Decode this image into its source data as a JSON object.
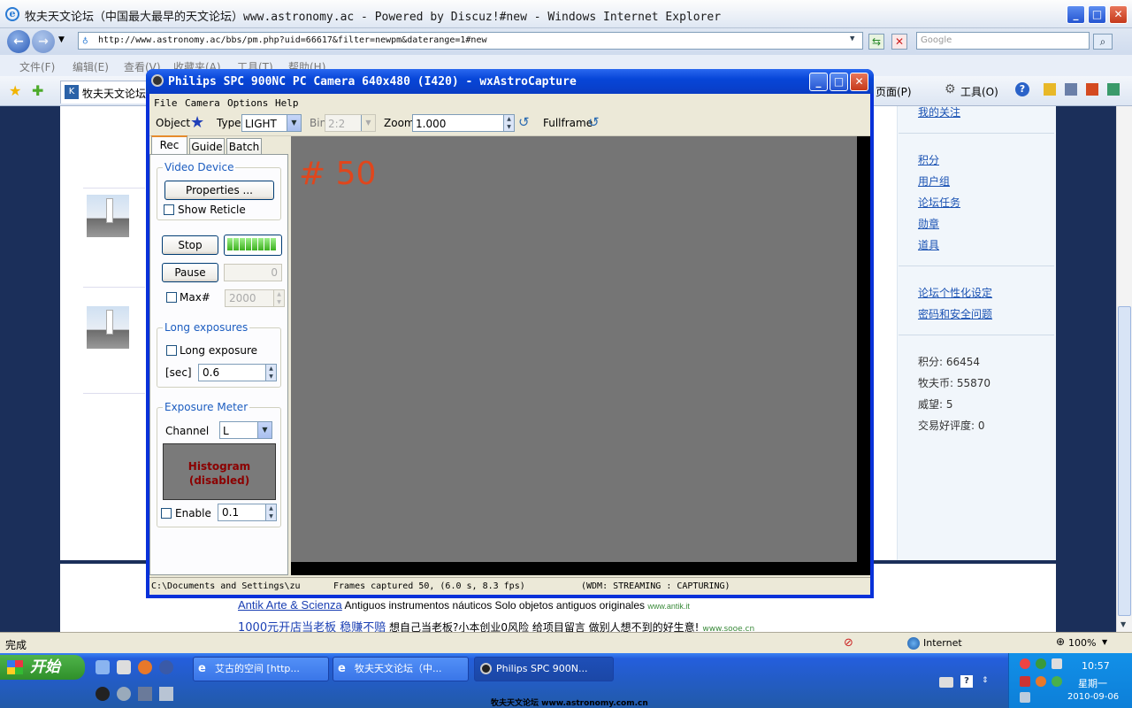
{
  "browser": {
    "title": "牧夫天文论坛（中国最大最早的天文论坛）www.astronomy.ac - Powered by Discuz!#new - Windows Internet Explorer",
    "address": "http://www.astronomy.ac/bbs/pm.php?uid=66617&filter=newpm&daterange=1#new",
    "search_placeholder": "Google",
    "menu": [
      "文件(F)",
      "编辑(E)",
      "查看(V)",
      "收藏夹(A)",
      "工具(T)",
      "帮助(H)"
    ],
    "fav_tab": "牧夫天文论坛",
    "cmd_page": "页面(P)",
    "cmd_tools": "工具(O)",
    "status_left": "完成",
    "status_zone": "Internet",
    "status_zoom": "100%"
  },
  "page": {
    "top_link": "我的关注",
    "right_links": [
      "积分",
      "用户组",
      "论坛任务",
      "勋章",
      "道具"
    ],
    "right_links2": [
      "论坛个性化设定",
      "密码和安全问题"
    ],
    "stats": [
      "积分: 66454",
      "牧夫币: 55870",
      "威望: 5",
      "交易好评度: 0"
    ],
    "ad1_title": "Antik Arte & Scienza",
    "ad1_text": "Antiguos instrumentos náuticos Solo objetos antiguos originales",
    "ad1_url": "www.antik.it",
    "ad2_title": "1000元开店当老板  稳赚不赔",
    "ad2_text": "想自己当老板?小本创业0风险  给项目留言  做别人想不到的好生意!",
    "ad2_url": "www.sooe.cn"
  },
  "app": {
    "title": "Philips SPC 900NC PC Camera 640x480 (I420) - wxAstroCapture",
    "menu": [
      "File",
      "Camera",
      "Options",
      "Help"
    ],
    "toolbar": {
      "object_label": "Object",
      "type_label": "Type",
      "type_value": "LIGHT",
      "bin_label": "Bin",
      "bin_value": "2:2",
      "zoom_label": "Zoom",
      "zoom_value": "1.000",
      "fullframe_label": "Fullframe"
    },
    "tabs": [
      "Rec",
      "Guide",
      "Batch"
    ],
    "video_device_title": "Video Device",
    "properties_btn": "Properties ...",
    "show_reticle": "Show Reticle",
    "stop_btn": "Stop",
    "pause_btn": "Pause",
    "pause_value": "0",
    "max_label": "Max#",
    "max_value": "2000",
    "long_exp_title": "Long exposures",
    "long_exp_chk": "Long exposure",
    "sec_label": "[sec]",
    "sec_value": "0.6",
    "exp_meter_title": "Exposure Meter",
    "channel_label": "Channel",
    "channel_value": "L",
    "histogram_line1": "Histogram",
    "histogram_line2": "(disabled)",
    "enable_label": "Enable",
    "enable_value": "0.1",
    "overlay_text": "# 50",
    "status_path": "C:\\Documents and Settings\\zu",
    "status_frames": "Frames captured 50,  (6.0 s, 8.3 fps)",
    "status_mode": "(WDM: STREAMING : CAPTURING)"
  },
  "taskbar": {
    "start": "开始",
    "tasks": [
      "艾古的空间 [http...",
      "牧夫天文论坛（中...",
      "Philips SPC 900N..."
    ],
    "time": "10:57",
    "weekday": "星期一",
    "date": "2010-09-06",
    "watermark": "牧夫天文论坛 www.astronomy.com.cn"
  },
  "colors": {
    "xp_blue": "#0a3cc4",
    "overlay_orange": "#e0461c",
    "link_blue": "#1a52b3"
  }
}
